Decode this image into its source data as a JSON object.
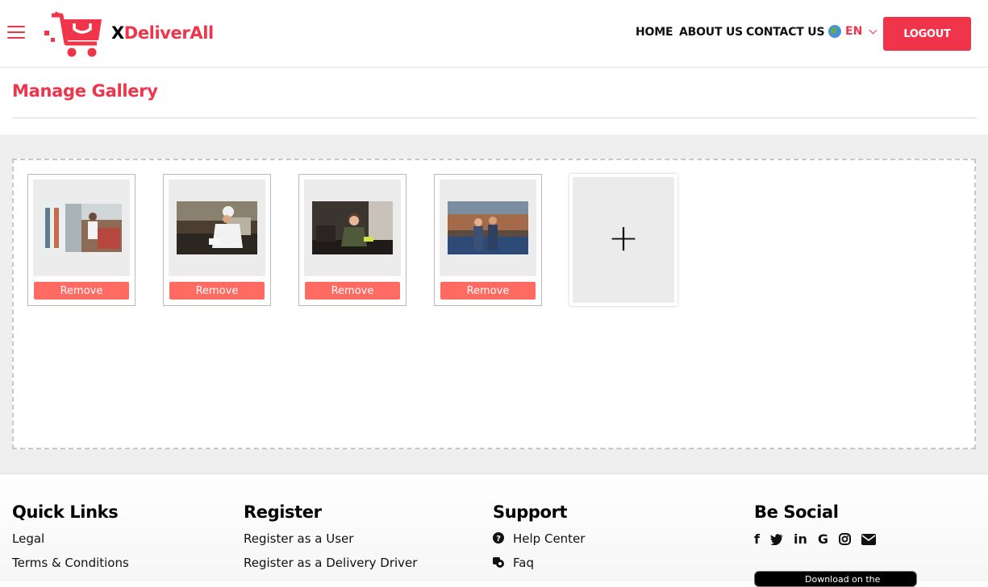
{
  "header": {
    "brand_x": "X",
    "brand_rest": "DeliverAll",
    "nav": {
      "home": "HOME",
      "about": "ABOUT US",
      "contact": "CONTACT US"
    },
    "language": "EN",
    "logout_label": "LOGOUT"
  },
  "page": {
    "title": "Manage Gallery"
  },
  "gallery": {
    "items": [
      {
        "remove_label": "Remove"
      },
      {
        "remove_label": "Remove"
      },
      {
        "remove_label": "Remove"
      },
      {
        "remove_label": "Remove"
      }
    ],
    "add_symbol": "+"
  },
  "footer": {
    "quick_links": {
      "title": "Quick Links",
      "items": [
        "Legal",
        "Terms & Conditions"
      ]
    },
    "register": {
      "title": "Register",
      "items": [
        "Register as a User",
        "Register as a Delivery Driver"
      ]
    },
    "support": {
      "title": "Support",
      "items": [
        "Help Center",
        "Faq"
      ]
    },
    "social": {
      "title": "Be Social",
      "icons": [
        "facebook-icon",
        "twitter-icon",
        "linkedin-icon",
        "google-icon",
        "instagram-icon",
        "mail-icon"
      ]
    },
    "app_badge": "Download on the"
  },
  "colors": {
    "brand": "#f0344a",
    "remove": "#ff6b63"
  }
}
